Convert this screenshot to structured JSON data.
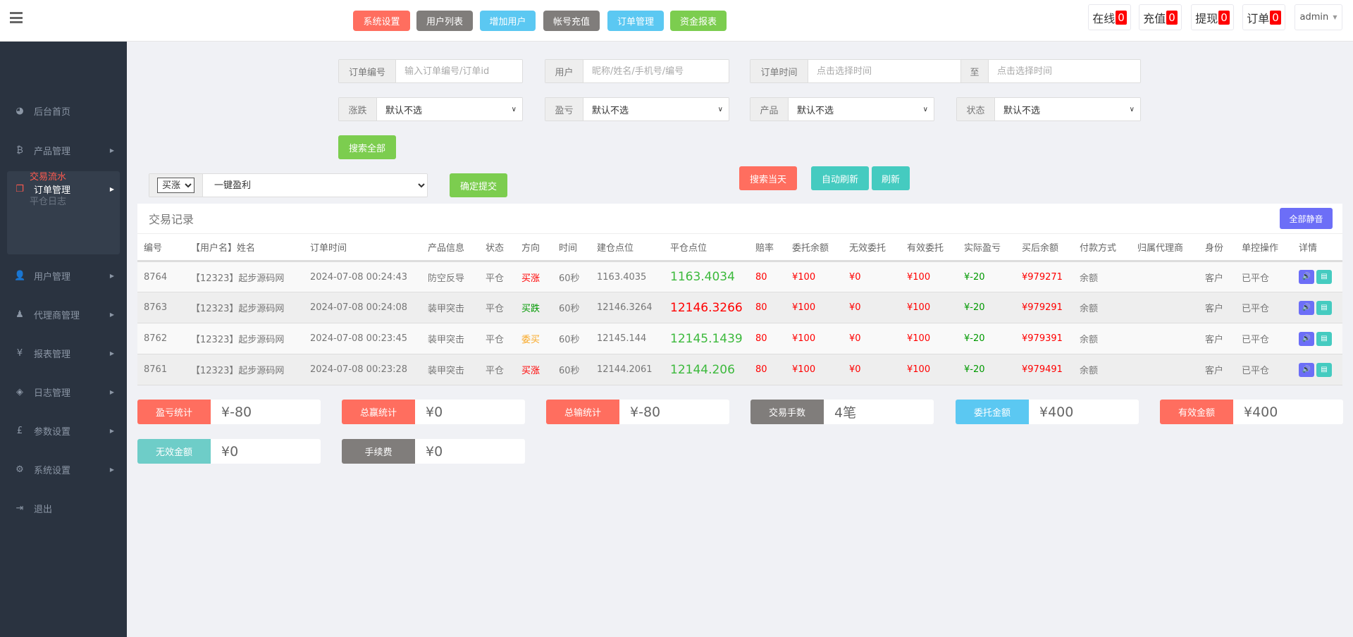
{
  "header": {
    "nav_buttons": [
      {
        "label": "系统设置",
        "color": "#ff6e5f"
      },
      {
        "label": "用户列表",
        "color": "#807d7b"
      },
      {
        "label": "增加用户",
        "color": "#5bc8f2"
      },
      {
        "label": "帐号充值",
        "color": "#807d7b"
      },
      {
        "label": "订单管理",
        "color": "#5bc8f2"
      },
      {
        "label": "资金报表",
        "color": "#7ccd4f"
      }
    ],
    "stats": [
      {
        "label": "在线",
        "count": "0"
      },
      {
        "label": "充值",
        "count": "0"
      },
      {
        "label": "提现",
        "count": "0"
      },
      {
        "label": "订单",
        "count": "0"
      }
    ],
    "user": "admin"
  },
  "sidebar": {
    "items": [
      {
        "label": "后台首页",
        "icon": "dashboard-icon"
      },
      {
        "label": "产品管理",
        "icon": "bitcoin-icon"
      },
      {
        "label": "订单管理",
        "icon": "copy-icon"
      },
      {
        "label": "用户管理",
        "icon": "user-icon"
      },
      {
        "label": "代理商管理",
        "icon": "user-secret-icon"
      },
      {
        "label": "报表管理",
        "icon": "yen-icon"
      },
      {
        "label": "日志管理",
        "icon": "ticket-icon"
      },
      {
        "label": "参数设置",
        "icon": "gbp-icon"
      },
      {
        "label": "系统设置",
        "icon": "cogs-icon"
      },
      {
        "label": "退出",
        "icon": "sign-out-icon"
      }
    ],
    "sub_items": [
      "交易流水",
      "平仓日志"
    ]
  },
  "filters": {
    "order_no": {
      "label": "订单编号",
      "placeholder": "输入订单编号/订单id"
    },
    "user": {
      "label": "用户",
      "placeholder": "昵称/姓名/手机号/编号"
    },
    "order_time": {
      "label": "订单时间",
      "placeholder": "点击选择时间",
      "to": "至",
      "placeholder2": "点击选择时间"
    },
    "selects": [
      {
        "label": "涨跌",
        "value": "默认不选"
      },
      {
        "label": "盈亏",
        "value": "默认不选"
      },
      {
        "label": "产品",
        "value": "默认不选"
      },
      {
        "label": "状态",
        "value": "默认不选"
      }
    ],
    "search_all": "搜索全部"
  },
  "control": {
    "direction": "买涨",
    "action": "一键盈利",
    "submit": "确定提交",
    "search_today": "搜索当天",
    "auto_refresh": "自动刷新",
    "refresh": "刷新"
  },
  "panel": {
    "title": "交易记录",
    "mute_all": "全部静音",
    "columns": [
      "编号",
      "【用户名】姓名",
      "订单时间",
      "产品信息",
      "状态",
      "方向",
      "时间",
      "建仓点位",
      "平仓点位",
      "赔率",
      "委托余额",
      "无效委托",
      "有效委托",
      "实际盈亏",
      "买后余额",
      "付款方式",
      "归属代理商",
      "身份",
      "单控操作",
      "详情"
    ],
    "rows": [
      {
        "id": "8764",
        "user": "【12323】起步源码网",
        "time": "2024-07-08 00:24:43",
        "product": "防空反导",
        "status": "平仓",
        "direction": "买涨",
        "dir_color": "red",
        "duration": "60秒",
        "open": "1163.4035",
        "close": "1163.4034",
        "close_color": "lgreen",
        "rate": "80",
        "amount": "¥100",
        "invalid": "¥0",
        "valid": "¥100",
        "pl": "¥-20",
        "balance": "¥979271",
        "pay": "余额",
        "agent": "",
        "role": "客户",
        "control": "已平仓"
      },
      {
        "id": "8763",
        "user": "【12323】起步源码网",
        "time": "2024-07-08 00:24:08",
        "product": "装甲突击",
        "status": "平仓",
        "direction": "买跌",
        "dir_color": "green",
        "duration": "60秒",
        "open": "12146.3264",
        "close": "12146.3266",
        "close_color": "red",
        "rate": "80",
        "amount": "¥100",
        "invalid": "¥0",
        "valid": "¥100",
        "pl": "¥-20",
        "balance": "¥979291",
        "pay": "余额",
        "agent": "",
        "role": "客户",
        "control": "已平仓"
      },
      {
        "id": "8762",
        "user": "【12323】起步源码网",
        "time": "2024-07-08 00:23:45",
        "product": "装甲突击",
        "status": "平仓",
        "direction": "委买",
        "dir_color": "orange",
        "duration": "60秒",
        "open": "12145.144",
        "close": "12145.1439",
        "close_color": "lgreen",
        "rate": "80",
        "amount": "¥100",
        "invalid": "¥0",
        "valid": "¥100",
        "pl": "¥-20",
        "balance": "¥979391",
        "pay": "余额",
        "agent": "",
        "role": "客户",
        "control": "已平仓"
      },
      {
        "id": "8761",
        "user": "【12323】起步源码网",
        "time": "2024-07-08 00:23:28",
        "product": "装甲突击",
        "status": "平仓",
        "direction": "买涨",
        "dir_color": "red",
        "duration": "60秒",
        "open": "12144.2061",
        "close": "12144.206",
        "close_color": "lgreen",
        "rate": "80",
        "amount": "¥100",
        "invalid": "¥0",
        "valid": "¥100",
        "pl": "¥-20",
        "balance": "¥979491",
        "pay": "余额",
        "agent": "",
        "role": "客户",
        "control": "已平仓"
      }
    ]
  },
  "summary": [
    {
      "label": "盈亏统计",
      "value": "¥-80",
      "color": "#ff6e5f"
    },
    {
      "label": "总赢统计",
      "value": "¥0",
      "color": "#ff6e5f"
    },
    {
      "label": "总输统计",
      "value": "¥-80",
      "color": "#ff6e5f"
    },
    {
      "label": "交易手数",
      "value": "4笔",
      "color": "#807d7b"
    },
    {
      "label": "委托金额",
      "value": "¥400",
      "color": "#5bc8f2"
    },
    {
      "label": "有效金额",
      "value": "¥400",
      "color": "#ff6e5f"
    },
    {
      "label": "无效金额",
      "value": "¥0",
      "color": "#6ecdc8"
    },
    {
      "label": "手续费",
      "value": "¥0",
      "color": "#807d7b"
    }
  ]
}
